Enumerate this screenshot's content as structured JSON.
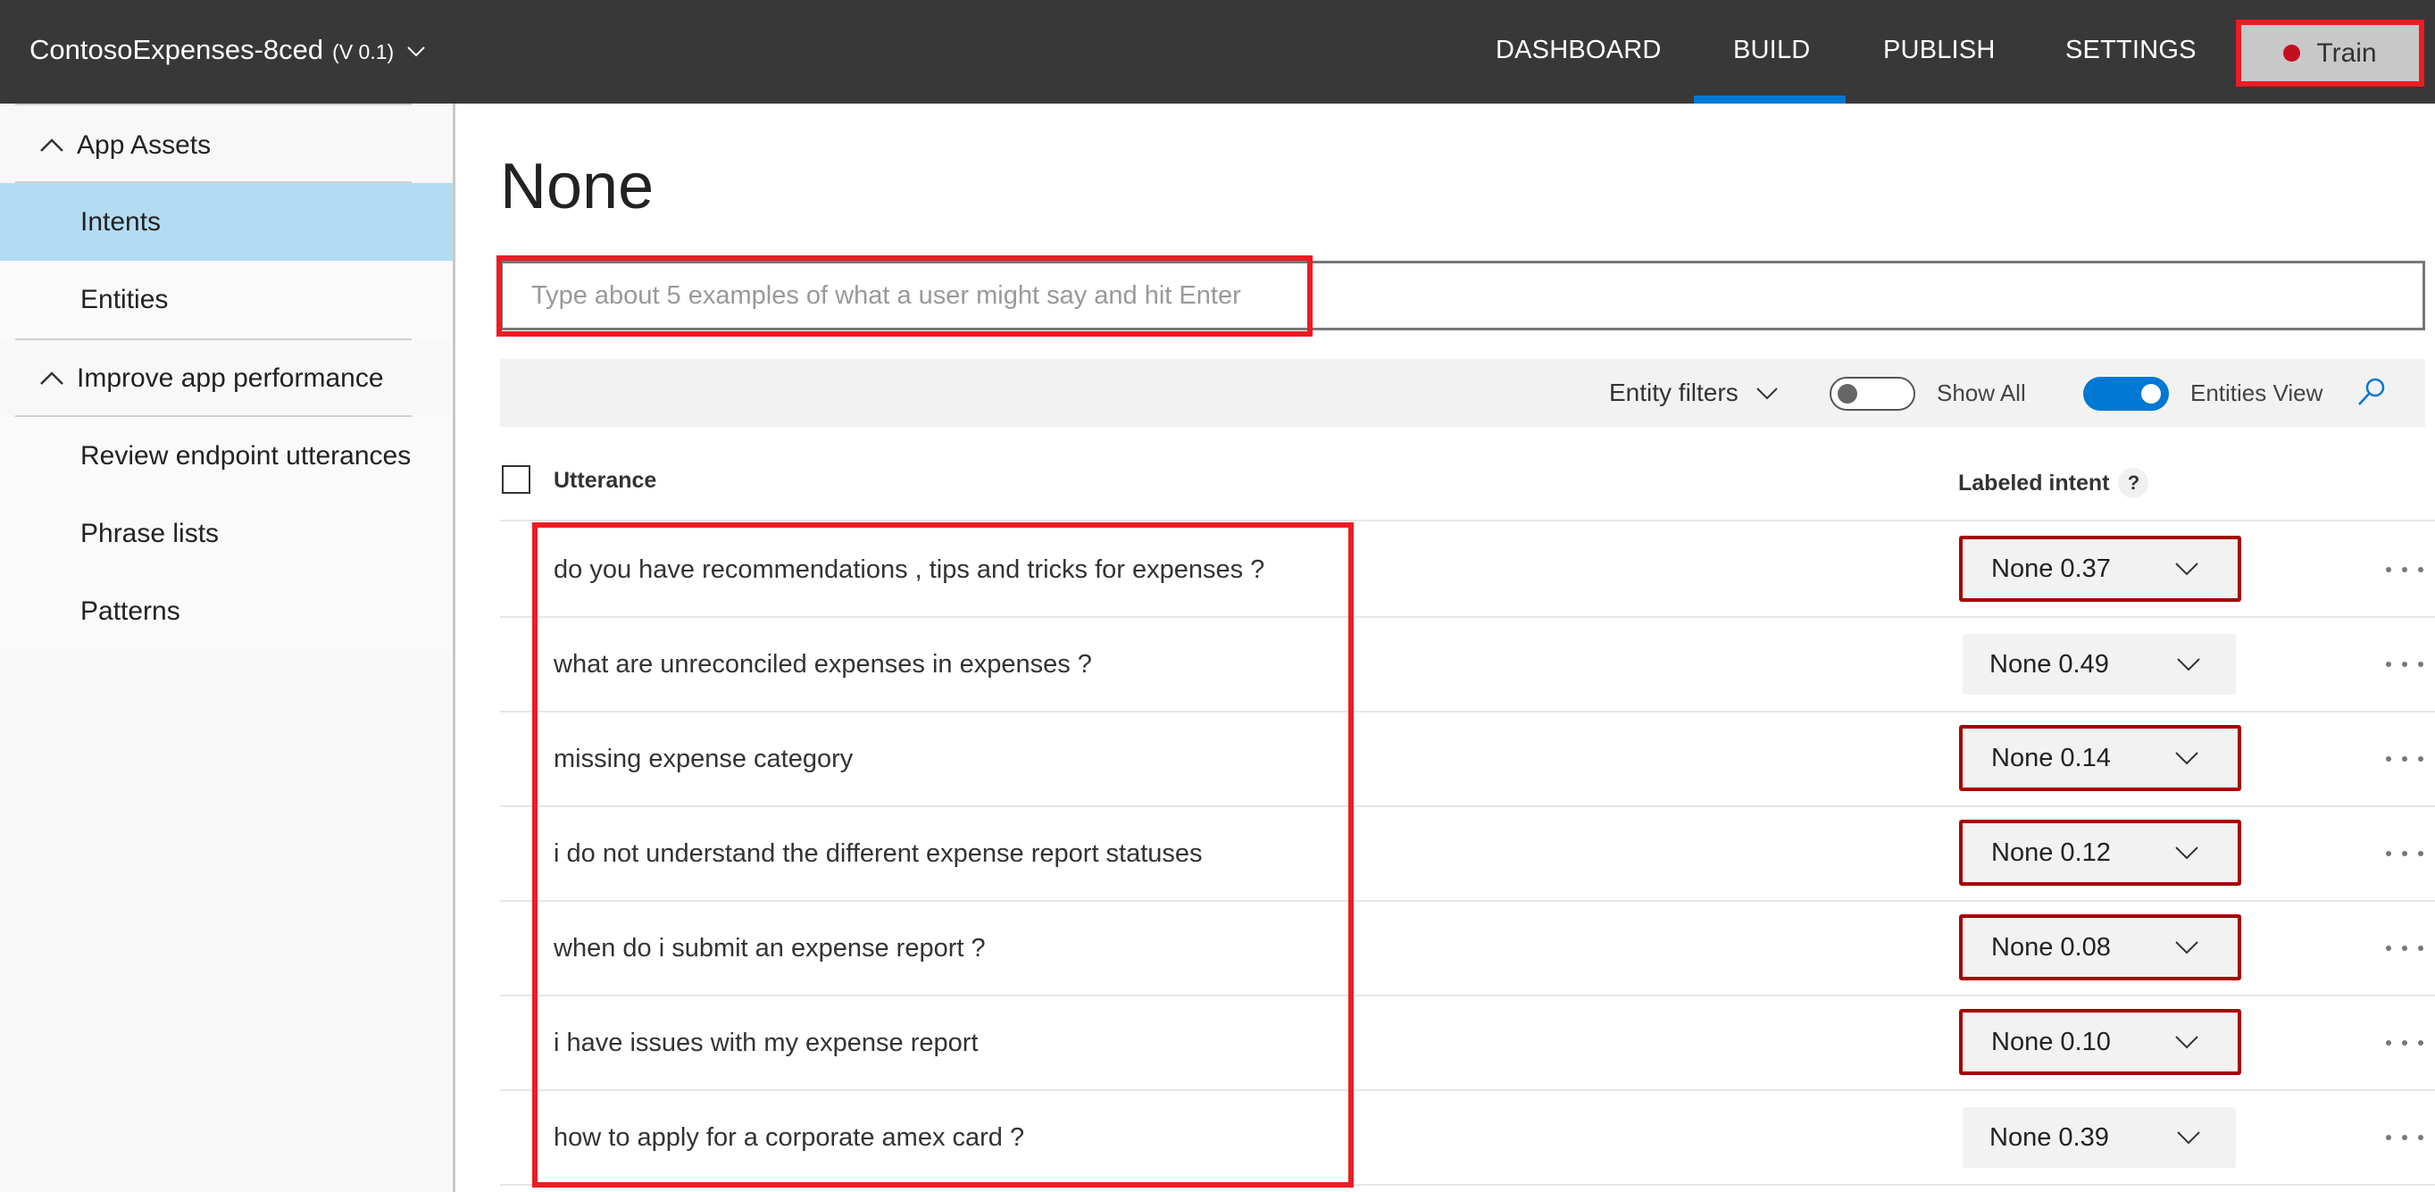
{
  "header": {
    "app_name": "ContosoExpenses-8ced",
    "version": "(V 0.1)",
    "nav": [
      {
        "label": "DASHBOARD",
        "active": false
      },
      {
        "label": "BUILD",
        "active": true
      },
      {
        "label": "PUBLISH",
        "active": false
      },
      {
        "label": "SETTINGS",
        "active": false
      }
    ],
    "train_label": "Train",
    "train_status_color": "#c50f1f"
  },
  "sidebar": {
    "groups": [
      {
        "label": "App Assets",
        "expanded": true,
        "items": [
          {
            "label": "Intents",
            "active": true
          },
          {
            "label": "Entities",
            "active": false
          }
        ]
      },
      {
        "label": "Improve app performance",
        "expanded": true,
        "items": [
          {
            "label": "Review endpoint utterances",
            "active": false
          },
          {
            "label": "Phrase lists",
            "active": false
          },
          {
            "label": "Patterns",
            "active": false
          }
        ]
      }
    ]
  },
  "main": {
    "title": "None",
    "utterance_input": {
      "value": "",
      "placeholder": "Type about 5 examples of what a user might say and hit Enter"
    },
    "toolbar": {
      "entity_filters_label": "Entity filters",
      "show_all_label": "Show All",
      "show_all_on": false,
      "entities_view_label": "Entities View",
      "entities_view_on": true
    },
    "table": {
      "columns": [
        "Utterance",
        "Labeled intent"
      ],
      "help_glyph": "?",
      "rows": [
        {
          "utterance": "do you have recommendations , tips and tricks for expenses ?",
          "intent": "None 0.37",
          "flagged": true
        },
        {
          "utterance": "what are unreconciled expenses in expenses ?",
          "intent": "None 0.49",
          "flagged": false
        },
        {
          "utterance": "missing expense category",
          "intent": "None 0.14",
          "flagged": true
        },
        {
          "utterance": "i do not understand the different expense report statuses",
          "intent": "None 0.12",
          "flagged": true
        },
        {
          "utterance": "when do i submit an expense report ?",
          "intent": "None 0.08",
          "flagged": true
        },
        {
          "utterance": "i have issues with my expense report",
          "intent": "None 0.10",
          "flagged": true
        },
        {
          "utterance": "how to apply for a corporate amex card ?",
          "intent": "None 0.39",
          "flagged": false
        }
      ]
    }
  },
  "colors": {
    "header_bg": "#383838",
    "accent": "#0078d4",
    "active_sidebar": "#b3dcf2",
    "annotation_red": "#ed1c24",
    "flag_border": "#a80000"
  }
}
